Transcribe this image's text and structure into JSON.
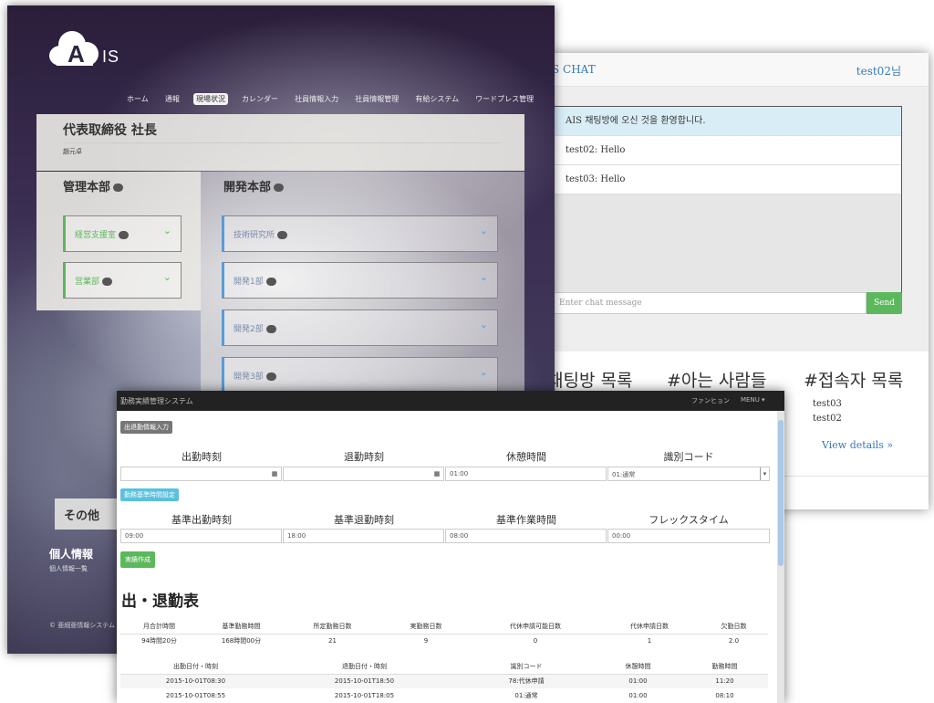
{
  "chat": {
    "brand": "S CHAT",
    "user": "test02님",
    "messages": [
      {
        "text": "AIS 채팅방에 오신 것을 환영합니다.",
        "type": "info"
      },
      {
        "text": "test02: Hello",
        "type": "normal"
      },
      {
        "text": "test03: Hello",
        "type": "normal"
      }
    ],
    "input_placeholder": "Enter chat message",
    "send_label": "Send",
    "sections": [
      "채팅방 목록",
      "#아는 사람들",
      "#접속자 목록"
    ],
    "online_users": [
      "test03",
      "test02"
    ],
    "details_link": "View details »"
  },
  "ais": {
    "logo_a": "A",
    "logo_is": "IS",
    "nav": [
      "ホーム",
      "通報",
      "現場状況",
      "カレンダー",
      "社員情報入力",
      "社員情報管理",
      "有給システム",
      "ワードプレス管理"
    ],
    "nav_active": "現場状況",
    "ceo_title": "代表取締役 社長",
    "ceo_name": "趙元卓",
    "dept1_name": "管理本部",
    "dept1_sections": [
      "経営支援室",
      "営業部"
    ],
    "dept2_name": "開発本部",
    "dept2_sections": [
      "技術研究所",
      "開発1部",
      "開発2部",
      "開発3部"
    ],
    "other": "その他",
    "personal": "個人情報",
    "personal_sub": "個人情報一覧",
    "copyright": "© 亜細亜情報システム"
  },
  "att": {
    "app_title": "勤務実績管理システム",
    "nav_right1": "ファンヒョン",
    "nav_right2": "MENU ▾",
    "badge_input": "出退勤情報入力",
    "row1_headers": [
      "出勤時刻",
      "退勤時刻",
      "休憩時間",
      "識別コード"
    ],
    "row1_values": [
      "",
      "",
      "01:00",
      "01:通常"
    ],
    "badge_base": "勤務基準時間設定",
    "row2_headers": [
      "基準出勤時刻",
      "基準退勤時刻",
      "基準作業時間",
      "フレックスタイム"
    ],
    "row2_values": [
      "09:00",
      "18:00",
      "08:00",
      "00:00"
    ],
    "create_button": "実績作成",
    "table_title": "出・退勤表",
    "summary_headers": [
      "月合計時間",
      "基準勤務時間",
      "所定勤務日数",
      "実勤務日数",
      "代休申請可能日数",
      "代休申請日数",
      "欠勤日数"
    ],
    "summary_values": [
      "94時間20分",
      "168時間00分",
      "21",
      "9",
      "0",
      "1",
      "2.0"
    ],
    "detail_headers": [
      "出勤日付・時刻",
      "退勤日付・時刻",
      "識別コード",
      "休憩時間",
      "勤務時間"
    ],
    "detail_rows": [
      [
        "2015-10-01T08:30",
        "2015-10-01T18:50",
        "78:代休申請",
        "01:00",
        "11:20"
      ],
      [
        "2015-10-01T08:55",
        "2015-10-01T18:05",
        "01:通常",
        "01:00",
        "08:10"
      ]
    ]
  }
}
